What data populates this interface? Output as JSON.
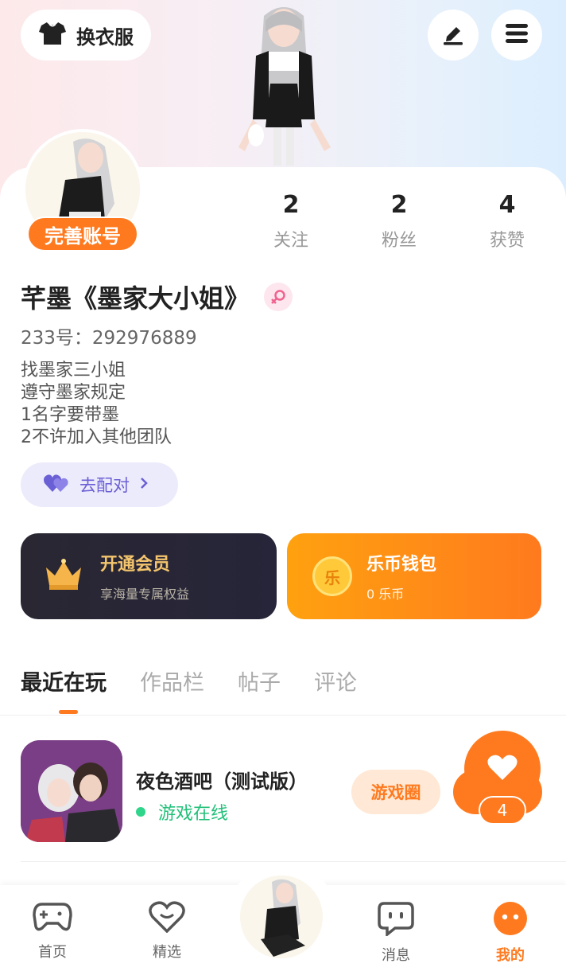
{
  "header": {
    "outfit_label": "换衣服",
    "icons": {
      "outfit": "tshirt-icon",
      "edit": "pencil-icon",
      "menu": "menu-icon"
    }
  },
  "profile": {
    "complete_badge": "完善账号",
    "stats": [
      {
        "value": "2",
        "label": "关注"
      },
      {
        "value": "2",
        "label": "粉丝"
      },
      {
        "value": "4",
        "label": "获赞"
      }
    ],
    "name": "芊墨《墨家大小姐》",
    "gender_icon": "female-icon",
    "uid": "233号：292976889",
    "bio": [
      "找墨家三小姐",
      "遵守墨家规定",
      "1名字要带墨",
      "2不许加入其他团队"
    ],
    "match_label": "去配对"
  },
  "cards": {
    "vip": {
      "title": "开通会员",
      "subtitle": "享海量专属权益"
    },
    "wallet": {
      "title": "乐币钱包",
      "subtitle": "0 乐币",
      "coin_glyph": "乐"
    }
  },
  "tabs": [
    "最近在玩",
    "作品栏",
    "帖子",
    "评论"
  ],
  "recent_games": [
    {
      "title": "夜色酒吧（测试版）",
      "status": "游戏在线",
      "circle_label": "游戏圈"
    }
  ],
  "like": {
    "count": "4"
  },
  "bottom_nav": [
    {
      "label": "首页",
      "icon": "gamepad-icon"
    },
    {
      "label": "精选",
      "icon": "heart-chat-icon"
    },
    {
      "label": "消息",
      "icon": "message-icon"
    },
    {
      "label": "我的",
      "icon": "profile-face-icon"
    }
  ],
  "colors": {
    "accent": "#ff7a1f",
    "online": "#23c07a",
    "vip_gold": "#f4c56d",
    "match_purple": "#6b5fd6"
  }
}
